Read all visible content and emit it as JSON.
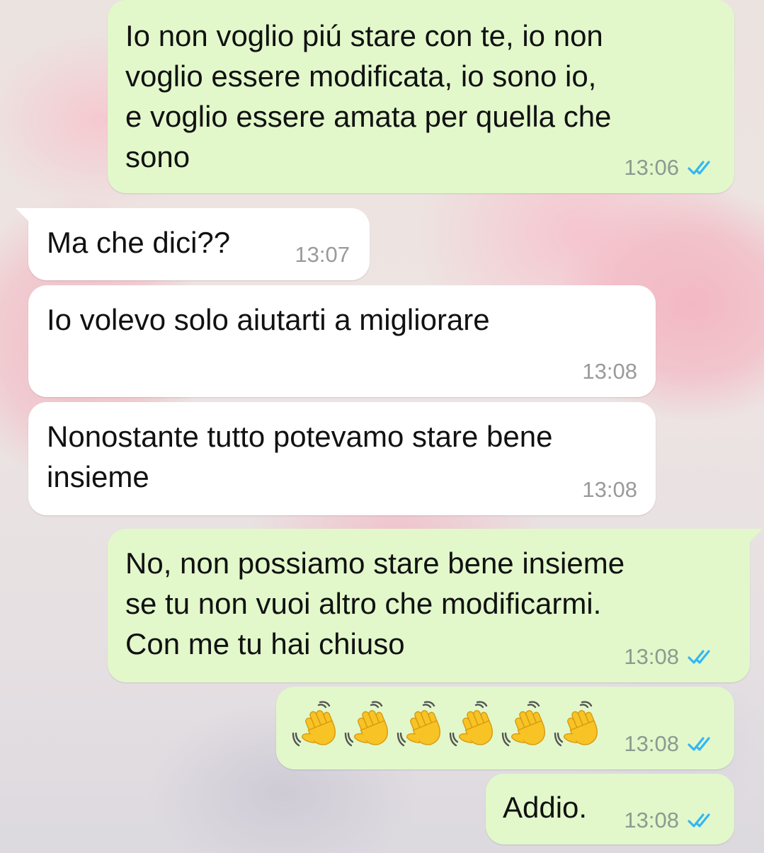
{
  "messages": [
    {
      "id": 1,
      "direction": "outgoing",
      "text": "Io non voglio piú stare con te, io non\nvoglio essere modificata, io sono io,\ne voglio essere amata per quella che\nsono",
      "time": "13:06",
      "status": "read"
    },
    {
      "id": 2,
      "direction": "incoming",
      "text": "Ma che dici??",
      "time": "13:07"
    },
    {
      "id": 3,
      "direction": "incoming",
      "text": "Io volevo solo aiutarti a migliorare",
      "time": "13:08"
    },
    {
      "id": 4,
      "direction": "incoming",
      "text": "Nonostante tutto potevamo stare bene\ninsieme",
      "time": "13:08"
    },
    {
      "id": 5,
      "direction": "outgoing",
      "text": "No, non possiamo stare bene insieme\nse tu non vuoi altro che modificarmi.\nCon me tu hai chiuso",
      "time": "13:08",
      "status": "read"
    },
    {
      "id": 6,
      "direction": "outgoing",
      "emoji": "waving-hand",
      "emoji_count": 6,
      "time": "13:08",
      "status": "read"
    },
    {
      "id": 7,
      "direction": "outgoing",
      "text": "Addio.",
      "time": "13:08",
      "status": "read"
    }
  ],
  "colors": {
    "outgoing_bubble": "#e2f8cb",
    "incoming_bubble": "#ffffff",
    "read_ticks": "#34b7f1",
    "timestamp": "#8c9a8f"
  },
  "icons": {
    "read_status": "double-check-icon",
    "emoji": "waving-hand-emoji"
  }
}
